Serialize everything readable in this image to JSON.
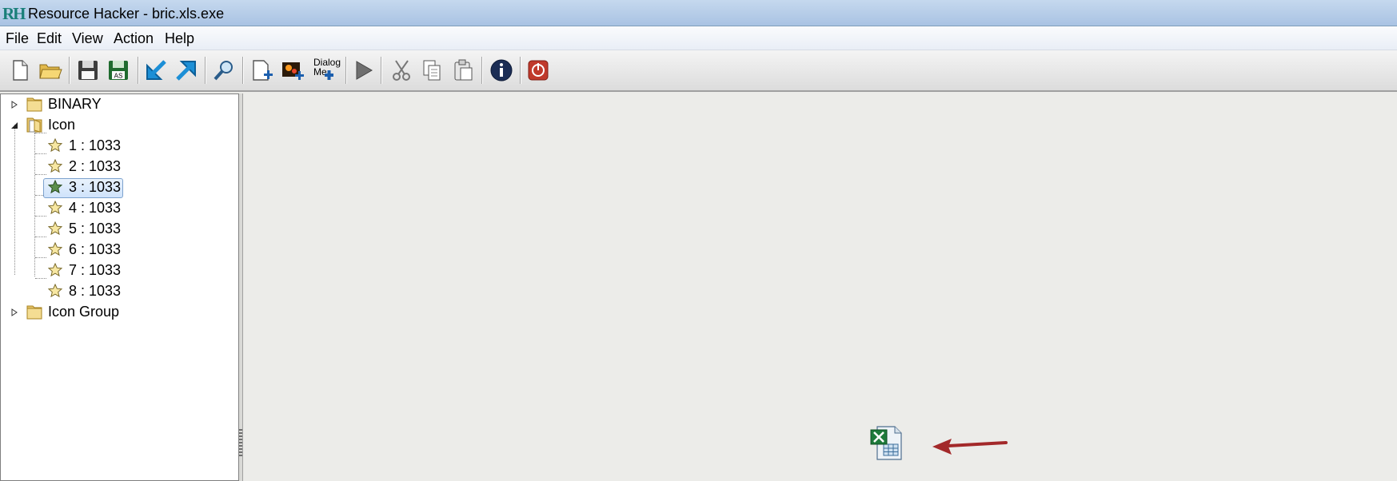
{
  "window": {
    "app_logo": "RH",
    "title": "Resource Hacker - bric.xls.exe"
  },
  "menu": [
    "File",
    "Edit",
    "View",
    "Action",
    "Help"
  ],
  "toolbar": {
    "icons": [
      "new-file-icon",
      "open-folder-icon",
      "save-icon",
      "save-as-icon",
      "import-icon",
      "export-icon",
      "search-icon",
      "add-resource-icon",
      "add-image-icon",
      "dialog-menu-icon",
      "run-script-icon",
      "cut-icon",
      "copy-icon",
      "paste-icon",
      "info-icon",
      "exit-icon"
    ],
    "save_as_label": "AS",
    "dialog_label_1": "Dialog",
    "dialog_label_2": "Me"
  },
  "tree": {
    "nodes": [
      {
        "label": "BINARY",
        "expanded": false
      },
      {
        "label": "Icon",
        "expanded": true,
        "children": [
          "1 : 1033",
          "2 : 1033",
          "3 : 1033",
          "4 : 1033",
          "5 : 1033",
          "6 : 1033",
          "7 : 1033",
          "8 : 1033"
        ],
        "selected_child": "3 : 1033"
      },
      {
        "label": "Icon Group",
        "expanded": false
      }
    ]
  },
  "preview": {
    "icon": "excel-document-icon",
    "arrow_color": "#a3292a"
  }
}
